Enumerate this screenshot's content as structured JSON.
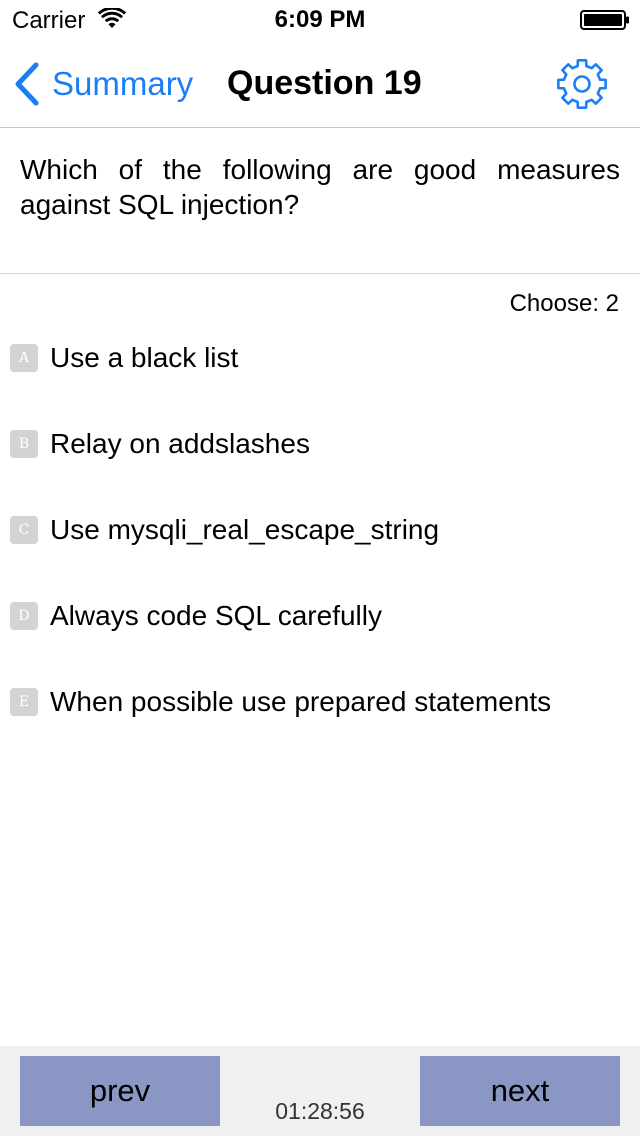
{
  "status_bar": {
    "carrier": "Carrier",
    "time": "6:09 PM"
  },
  "nav": {
    "back_label": "Summary",
    "title": "Question 19",
    "accent_color": "#1a7ef5",
    "settings_icon": "gear-icon"
  },
  "question": {
    "text": "Which of the following are good measures against SQL injection?",
    "choose_label": "Choose: 2"
  },
  "answers": [
    {
      "letter": "A",
      "text": "Use a black list"
    },
    {
      "letter": "B",
      "text": "Relay on addslashes"
    },
    {
      "letter": "C",
      "text": "Use mysqli_real_escape_string"
    },
    {
      "letter": "D",
      "text": "Always code SQL carefully"
    },
    {
      "letter": "E",
      "text": "When possible use prepared statements"
    }
  ],
  "toolbar": {
    "prev_label": "prev",
    "next_label": "next",
    "timer": "01:28:56",
    "button_color": "#8a96c4"
  }
}
